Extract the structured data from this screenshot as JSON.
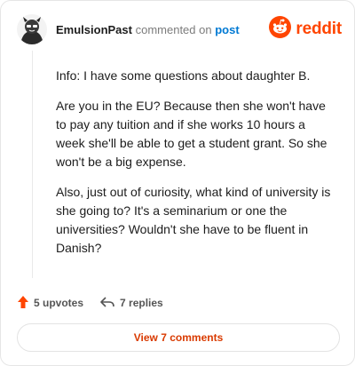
{
  "comment": {
    "username": "EmulsionPast",
    "action_text": "commented on",
    "post_link": "post",
    "paragraphs": [
      "Info: I have some questions about daughter B.",
      "Are you in the EU? Because then she won't have to pay any tuition and if she works 10 hours a week she'll be able to get a student grant. So she won't be a big expense.",
      "Also, just out of curiosity, what kind of university is she going to? It's a seminarium or one the universities? Wouldn't she have to be fluent in Danish?"
    ]
  },
  "brand": {
    "name": "reddit",
    "accent": "#ff4500"
  },
  "actions": {
    "upvotes": "5 upvotes",
    "replies": "7 replies"
  },
  "view_button": {
    "label": "View 7 comments",
    "color": "#d93a00"
  },
  "icons": [
    "avatar",
    "reddit-logo-icon",
    "upvote-arrow-icon",
    "reply-arrow-icon"
  ]
}
